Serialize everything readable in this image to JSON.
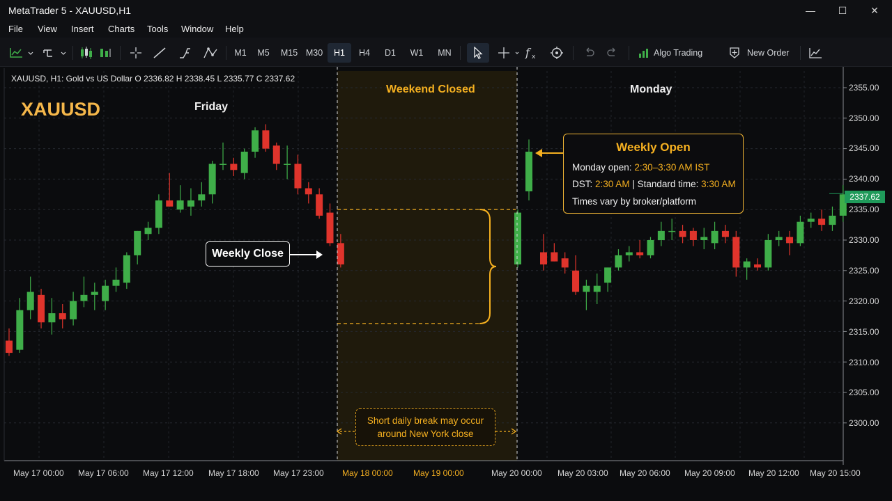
{
  "window": {
    "title": "MetaTrader 5 - XAUUSD,H1",
    "controls": {
      "minimize": "—",
      "maximize": "☐",
      "close": "✕"
    }
  },
  "menu": [
    "File",
    "View",
    "Insert",
    "Charts",
    "Tools",
    "Window",
    "Help"
  ],
  "toolbar": {
    "timeframes": [
      "M1",
      "M5",
      "M15",
      "M30",
      "H1",
      "H4",
      "D1",
      "W1",
      "MN"
    ],
    "active_timeframe": "H1",
    "algo_trading_label": "Algo Trading",
    "new_order_label": "New Order"
  },
  "chart": {
    "symbol_info": "XAUUSD, H1:  Gold vs US Dollar   O 2336.82   H 2338.45   L 2335.77   C 2337.62",
    "symbol": "XAUUSD",
    "friday_label": "Friday",
    "weekend_label": "Weekend Closed",
    "monday_label": "Monday",
    "weekly_close_label": "Weekly Close",
    "weekly_open": {
      "title": "Weekly Open",
      "monday_open_label": "Monday open:",
      "monday_open_value": "2:30–3:30 AM IST",
      "dst_label": "DST:",
      "dst_value": "2:30 AM",
      "standard_label": "| Standard time:",
      "standard_value": "3:30 AM",
      "note": "Times vary by broker/platform"
    },
    "break_note_line1": "Short daily break may occur",
    "break_note_line2": "around New York close",
    "current_price": "2337.62",
    "y_ticks": [
      "2355.00",
      "2350.00",
      "2345.00",
      "2340.00",
      "2335.00",
      "2330.00",
      "2325.00",
      "2320.00",
      "2315.00",
      "2310.00",
      "2305.00",
      "2300.00"
    ],
    "x_ticks": [
      "May 17  00:00",
      "May 17  06:00",
      "May 17  12:00",
      "May 17  18:00",
      "May 17  23:00",
      "May 18  00:00",
      "May 19  00:00",
      "May 20  00:00",
      "May 20  03:00",
      "May 20  06:00",
      "May 20  09:00",
      "May 20  12:00",
      "May 20  15:00"
    ],
    "colors": {
      "bull": "#3fae49",
      "bear": "#e0342c",
      "accent": "#f5b020",
      "weekend_fill": "#1f1a0c"
    }
  },
  "chart_data": {
    "type": "candlestick",
    "title": "XAUUSD, H1",
    "ylim": [
      2297,
      2357
    ],
    "friday": [
      {
        "o": 2313.5,
        "h": 2315.5,
        "l": 2311.0,
        "c": 2311.5
      },
      {
        "o": 2312.0,
        "h": 2320.5,
        "l": 2311.5,
        "c": 2318.5
      },
      {
        "o": 2318.5,
        "h": 2324.0,
        "l": 2317.0,
        "c": 2321.5
      },
      {
        "o": 2321.0,
        "h": 2322.0,
        "l": 2315.5,
        "c": 2316.5
      },
      {
        "o": 2316.5,
        "h": 2320.5,
        "l": 2314.5,
        "c": 2318.0
      },
      {
        "o": 2318.0,
        "h": 2319.5,
        "l": 2315.5,
        "c": 2317.0
      },
      {
        "o": 2317.0,
        "h": 2321.5,
        "l": 2316.0,
        "c": 2320.0
      },
      {
        "o": 2320.0,
        "h": 2324.0,
        "l": 2319.0,
        "c": 2321.0
      },
      {
        "o": 2321.0,
        "h": 2323.0,
        "l": 2318.5,
        "c": 2321.5
      },
      {
        "o": 2320.0,
        "h": 2323.5,
        "l": 2318.5,
        "c": 2322.5
      },
      {
        "o": 2322.5,
        "h": 2325.5,
        "l": 2321.5,
        "c": 2323.5
      },
      {
        "o": 2323.0,
        "h": 2328.0,
        "l": 2322.0,
        "c": 2327.5
      },
      {
        "o": 2327.5,
        "h": 2331.5,
        "l": 2326.0,
        "c": 2331.5
      },
      {
        "o": 2331.0,
        "h": 2333.0,
        "l": 2330.0,
        "c": 2332.0
      },
      {
        "o": 2332.0,
        "h": 2337.5,
        "l": 2331.0,
        "c": 2336.5
      },
      {
        "o": 2336.5,
        "h": 2341.0,
        "l": 2335.5,
        "c": 2335.5
      },
      {
        "o": 2335.0,
        "h": 2339.0,
        "l": 2334.5,
        "c": 2336.5
      },
      {
        "o": 2335.5,
        "h": 2338.5,
        "l": 2334.0,
        "c": 2336.5
      },
      {
        "o": 2336.5,
        "h": 2339.5,
        "l": 2335.5,
        "c": 2337.5
      },
      {
        "o": 2337.5,
        "h": 2343.0,
        "l": 2336.0,
        "c": 2342.5
      },
      {
        "o": 2342.5,
        "h": 2346.0,
        "l": 2341.5,
        "c": 2342.5
      },
      {
        "o": 2342.5,
        "h": 2343.5,
        "l": 2340.5,
        "c": 2341.5
      },
      {
        "o": 2341.0,
        "h": 2345.0,
        "l": 2340.0,
        "c": 2344.5
      },
      {
        "o": 2344.5,
        "h": 2348.5,
        "l": 2343.5,
        "c": 2348.0
      },
      {
        "o": 2348.0,
        "h": 2349.0,
        "l": 2344.5,
        "c": 2345.0
      },
      {
        "o": 2345.5,
        "h": 2346.0,
        "l": 2341.5,
        "c": 2342.5
      },
      {
        "o": 2342.5,
        "h": 2345.5,
        "l": 2340.0,
        "c": 2342.5
      },
      {
        "o": 2342.5,
        "h": 2344.0,
        "l": 2337.5,
        "c": 2338.5
      },
      {
        "o": 2338.5,
        "h": 2339.5,
        "l": 2336.0,
        "c": 2337.5
      },
      {
        "o": 2337.5,
        "h": 2338.5,
        "l": 2333.5,
        "c": 2334.0
      },
      {
        "o": 2334.5,
        "h": 2336.0,
        "l": 2329.0,
        "c": 2329.5
      },
      {
        "o": 2329.5,
        "h": 2331.0,
        "l": 2325.5,
        "c": 2326.0
      }
    ],
    "monday": [
      {
        "o": 2326.0,
        "h": 2335.0,
        "l": 2325.5,
        "c": 2334.5
      },
      {
        "o": 2338.0,
        "h": 2346.5,
        "l": 2336.5,
        "c": 2344.5
      },
      {
        "o": 2328.0,
        "h": 2331.0,
        "l": 2325.0,
        "c": 2326.0
      },
      {
        "o": 2328.0,
        "h": 2329.5,
        "l": 2326.5,
        "c": 2326.5
      },
      {
        "o": 2327.0,
        "h": 2328.0,
        "l": 2324.5,
        "c": 2325.5
      },
      {
        "o": 2325.0,
        "h": 2327.5,
        "l": 2321.0,
        "c": 2321.5
      },
      {
        "o": 2321.5,
        "h": 2323.5,
        "l": 2318.5,
        "c": 2322.5
      },
      {
        "o": 2321.5,
        "h": 2324.5,
        "l": 2319.5,
        "c": 2322.5
      },
      {
        "o": 2323.0,
        "h": 2325.5,
        "l": 2321.5,
        "c": 2325.5
      },
      {
        "o": 2325.5,
        "h": 2328.5,
        "l": 2325.0,
        "c": 2327.5
      },
      {
        "o": 2327.5,
        "h": 2329.0,
        "l": 2326.5,
        "c": 2328.0
      },
      {
        "o": 2328.0,
        "h": 2330.0,
        "l": 2327.0,
        "c": 2327.5
      },
      {
        "o": 2327.5,
        "h": 2330.5,
        "l": 2327.0,
        "c": 2330.0
      },
      {
        "o": 2330.0,
        "h": 2333.0,
        "l": 2329.0,
        "c": 2331.5
      },
      {
        "o": 2331.5,
        "h": 2333.5,
        "l": 2330.0,
        "c": 2331.5
      },
      {
        "o": 2331.5,
        "h": 2332.5,
        "l": 2329.5,
        "c": 2330.5
      },
      {
        "o": 2331.5,
        "h": 2332.0,
        "l": 2329.0,
        "c": 2330.0
      },
      {
        "o": 2330.0,
        "h": 2332.0,
        "l": 2328.5,
        "c": 2330.5
      },
      {
        "o": 2329.5,
        "h": 2333.0,
        "l": 2328.5,
        "c": 2331.5
      },
      {
        "o": 2331.5,
        "h": 2332.5,
        "l": 2329.5,
        "c": 2330.5
      },
      {
        "o": 2330.5,
        "h": 2331.5,
        "l": 2324.0,
        "c": 2325.5
      },
      {
        "o": 2325.5,
        "h": 2327.0,
        "l": 2323.5,
        "c": 2326.5
      },
      {
        "o": 2326.0,
        "h": 2327.0,
        "l": 2325.0,
        "c": 2325.5
      },
      {
        "o": 2325.5,
        "h": 2331.0,
        "l": 2325.0,
        "c": 2330.0
      },
      {
        "o": 2330.0,
        "h": 2331.5,
        "l": 2329.0,
        "c": 2330.5
      },
      {
        "o": 2330.5,
        "h": 2331.5,
        "l": 2327.5,
        "c": 2329.5
      },
      {
        "o": 2329.5,
        "h": 2334.0,
        "l": 2329.0,
        "c": 2333.0
      },
      {
        "o": 2333.0,
        "h": 2334.5,
        "l": 2332.0,
        "c": 2333.5
      },
      {
        "o": 2333.5,
        "h": 2335.0,
        "l": 2331.5,
        "c": 2332.5
      },
      {
        "o": 2332.5,
        "h": 2335.5,
        "l": 2331.5,
        "c": 2334.0
      },
      {
        "o": 2334.0,
        "h": 2339.0,
        "l": 2333.0,
        "c": 2337.5
      }
    ]
  }
}
